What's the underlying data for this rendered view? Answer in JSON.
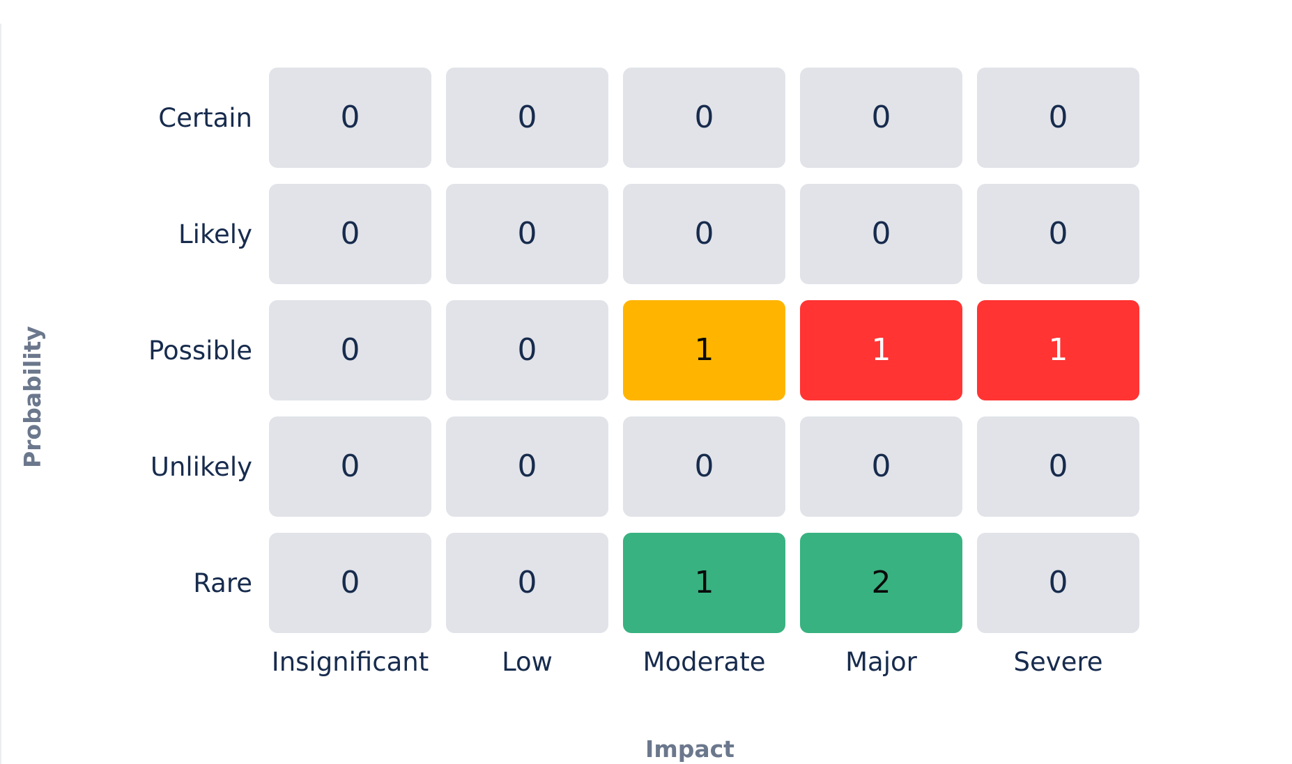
{
  "chart_data": {
    "type": "heatmap",
    "x_title": "Impact",
    "y_title": "Probability",
    "x_categories": [
      "Insignificant",
      "Low",
      "Moderate",
      "Major",
      "Severe"
    ],
    "y_categories": [
      "Certain",
      "Likely",
      "Possible",
      "Unlikely",
      "Rare"
    ],
    "values": [
      [
        0,
        0,
        0,
        0,
        0
      ],
      [
        0,
        0,
        0,
        0,
        0
      ],
      [
        0,
        0,
        1,
        1,
        1
      ],
      [
        0,
        0,
        0,
        0,
        0
      ],
      [
        0,
        0,
        1,
        2,
        0
      ]
    ],
    "cell_colors": [
      [
        "#e1e3e8",
        "#e1e3e8",
        "#e1e3e8",
        "#e1e3e8",
        "#e1e3e8"
      ],
      [
        "#e1e3e8",
        "#e1e3e8",
        "#e1e3e8",
        "#e1e3e8",
        "#e1e3e8"
      ],
      [
        "#e1e3e8",
        "#e1e3e8",
        "#ffb500",
        "#ff3433",
        "#ff3433"
      ],
      [
        "#e1e3e8",
        "#e1e3e8",
        "#e1e3e8",
        "#e1e3e8",
        "#e1e3e8"
      ],
      [
        "#e1e3e8",
        "#e1e3e8",
        "#38b280",
        "#38b280",
        "#e1e3e8"
      ]
    ],
    "text_colors": [
      [
        "#172b4d",
        "#172b4d",
        "#172b4d",
        "#172b4d",
        "#172b4d"
      ],
      [
        "#172b4d",
        "#172b4d",
        "#172b4d",
        "#172b4d",
        "#172b4d"
      ],
      [
        "#172b4d",
        "#172b4d",
        "#0b0b0b",
        "#ffffff",
        "#ffffff"
      ],
      [
        "#172b4d",
        "#172b4d",
        "#172b4d",
        "#172b4d",
        "#172b4d"
      ],
      [
        "#172b4d",
        "#172b4d",
        "#0b0b0b",
        "#0b0b0b",
        "#172b4d"
      ]
    ]
  }
}
